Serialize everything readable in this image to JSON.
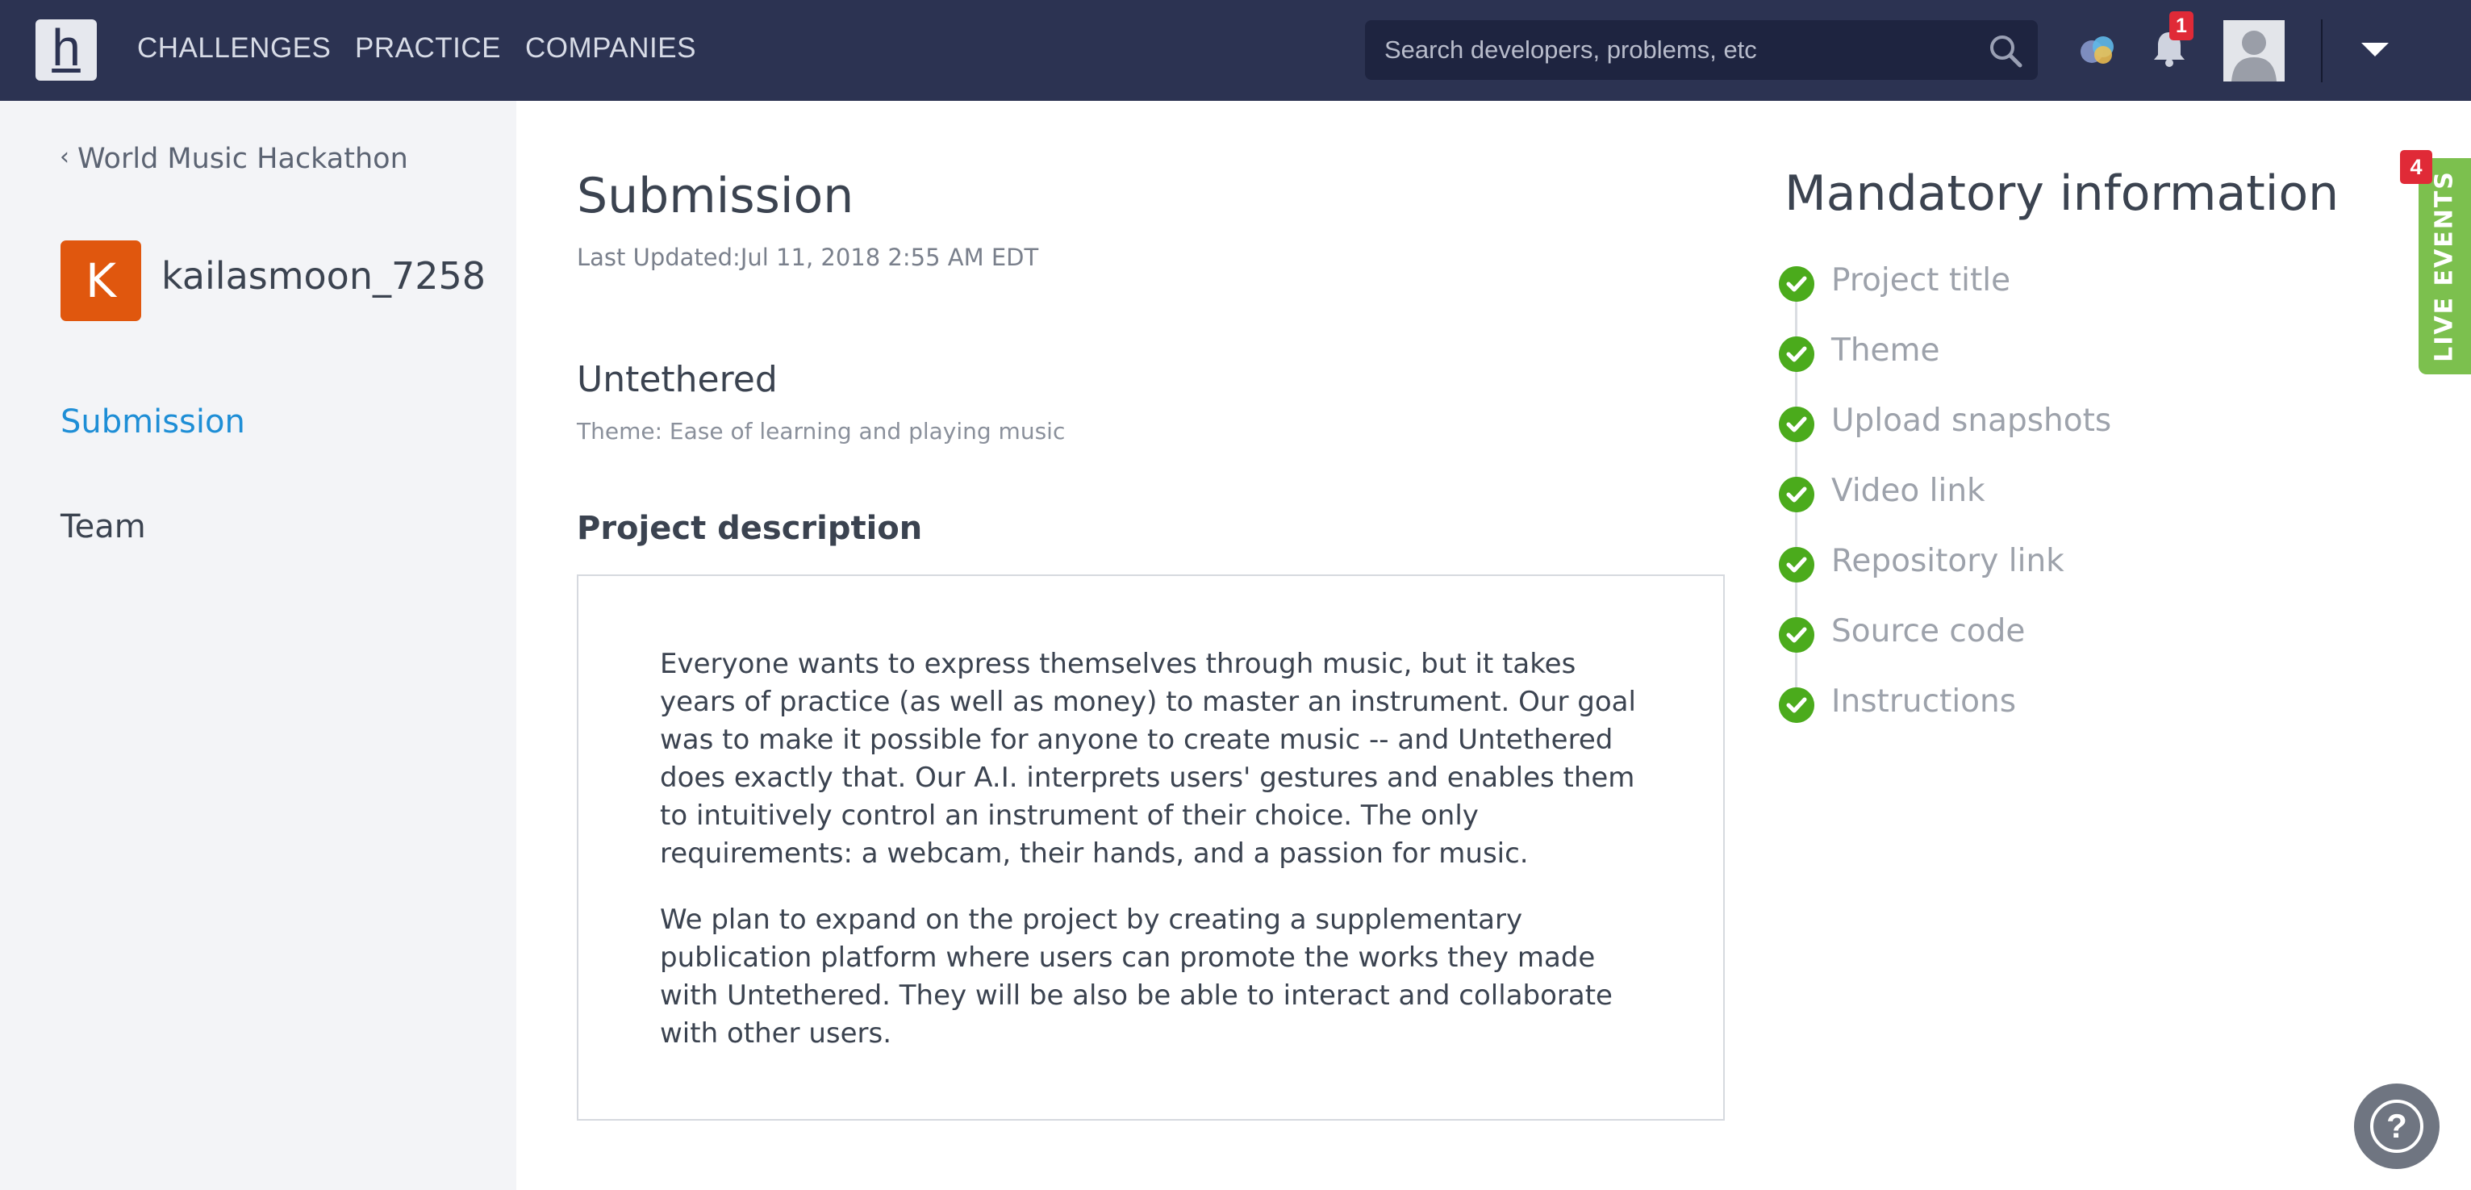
{
  "nav": {
    "logo_letter": "h",
    "links": [
      "CHALLENGES",
      "PRACTICE",
      "COMPANIES"
    ],
    "search_placeholder": "Search developers, problems, etc",
    "notification_count": "1",
    "icons": [
      "search-icon",
      "chat-bubbles-icon",
      "bell-icon",
      "user-avatar-icon",
      "caret-down-icon"
    ]
  },
  "sidebar": {
    "back_link": "World Music Hackathon",
    "user_initial": "K",
    "username": "kailasmoon_7258",
    "items": [
      {
        "label": "Submission",
        "active": true
      },
      {
        "label": "Team",
        "active": false
      }
    ]
  },
  "main": {
    "title": "Submission",
    "last_updated": "Last Updated:Jul 11, 2018 2:55 AM EDT",
    "project_title": "Untethered",
    "theme": "Theme: Ease of learning and playing music",
    "description_heading": "Project description",
    "description_paragraphs": [
      "Everyone wants to express themselves through music, but it takes years of practice (as well as money) to master an instrument. Our goal was to make it possible for anyone to create music -- and Untethered does exactly that. Our A.I. interprets users' gestures and enables them to intuitively control an instrument of their choice. The only requirements: a webcam, their hands, and a passion for music.",
      "We plan to expand on the project by creating a supplementary publication platform where users can promote the works they made with Untethered. They will be also be able to interact and collaborate with other users."
    ]
  },
  "mandatory": {
    "title": "Mandatory information",
    "items": [
      "Project title",
      "Theme",
      "Upload snapshots",
      "Video link",
      "Repository link",
      "Source code",
      "Instructions"
    ]
  },
  "live_events": {
    "label": "LIVE EVENTS",
    "count": "4"
  },
  "help": {
    "label": "?"
  },
  "colors": {
    "nav_bg": "#2c3352",
    "accent_blue": "#1e8ed6",
    "check_green": "#4bab1c",
    "live_green": "#7cc04e",
    "badge_red": "#e02a37",
    "user_badge_orange": "#e0570e"
  }
}
